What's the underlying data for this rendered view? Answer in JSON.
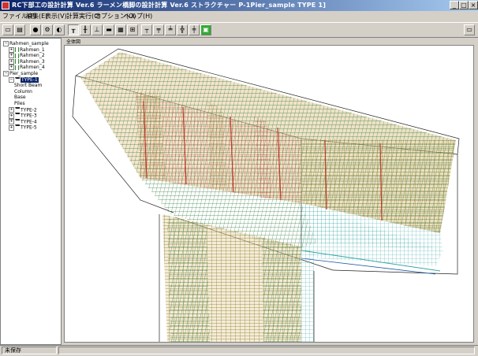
{
  "window": {
    "title": "RC下部工の設計計算 Ver.6 ラーメン橋脚の設計計算 Ver.6   ストラクチャー P-1Pier_sample TYPE 1]"
  },
  "menu": [
    "ファイル(F)",
    "編集(E)",
    "表示(V)",
    "計算実行(C)",
    "オプション(O)",
    "ヘルプ(H)"
  ],
  "tree": {
    "items": [
      {
        "label": "Rahmen_sample",
        "level": 0,
        "expander": "−",
        "icon": "none"
      },
      {
        "label": "Rahmen_1",
        "level": 1,
        "expander": "+",
        "icon": "i"
      },
      {
        "label": "Rahmen_2",
        "level": 1,
        "expander": "+",
        "icon": "i"
      },
      {
        "label": "Rahmen_3",
        "level": 1,
        "expander": "+",
        "icon": "i"
      },
      {
        "label": "Rahmen_4",
        "level": 1,
        "expander": "+",
        "icon": "i"
      },
      {
        "label": "Pier_sample",
        "level": 0,
        "expander": "−",
        "icon": "none"
      },
      {
        "label": "TYPE-1",
        "level": 1,
        "expander": "−",
        "icon": "t",
        "selected": true
      },
      {
        "label": "Short Beam",
        "level": 2,
        "expander": "",
        "icon": "none"
      },
      {
        "label": "Column",
        "level": 2,
        "expander": "",
        "icon": "none"
      },
      {
        "label": "Base",
        "level": 2,
        "expander": "",
        "icon": "none"
      },
      {
        "label": "Piles",
        "level": 2,
        "expander": "",
        "icon": "none"
      },
      {
        "label": "TYPE-2",
        "level": 1,
        "expander": "+",
        "icon": "t"
      },
      {
        "label": "TYPE-3",
        "level": 1,
        "expander": "+",
        "icon": "t"
      },
      {
        "label": "TYPE-4",
        "level": 1,
        "expander": "+",
        "icon": "t"
      },
      {
        "label": "TYPE-5",
        "level": 1,
        "expander": "+",
        "icon": "t"
      }
    ]
  },
  "view": {
    "tab_label": "全体図"
  },
  "status": {
    "text": "未保存"
  }
}
